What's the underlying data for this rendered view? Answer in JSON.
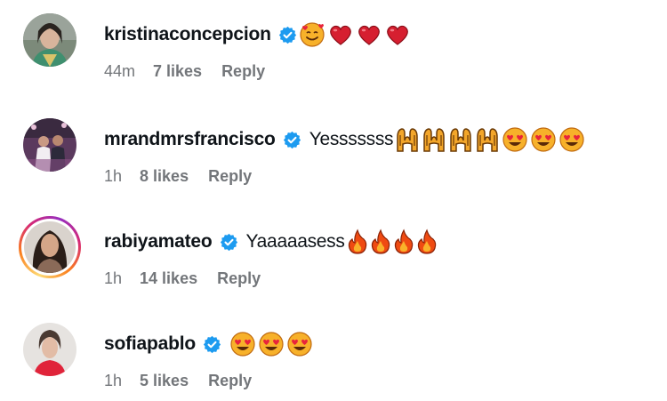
{
  "accent_verified": "#1d9bf0",
  "comments": [
    {
      "username": "kristinaconcepcion",
      "verified": true,
      "text": "",
      "emojis": [
        "smiling-face-with-hearts",
        "red-heart",
        "red-heart",
        "red-heart"
      ],
      "time": "44m",
      "likes": "7 likes",
      "reply": "Reply"
    },
    {
      "username": "mrandmrsfrancisco",
      "verified": true,
      "text": "Yesssssss",
      "emojis": [
        "raising-hands",
        "raising-hands",
        "raising-hands",
        "raising-hands",
        "heart-eyes",
        "heart-eyes",
        "heart-eyes"
      ],
      "time": "1h",
      "likes": "8 likes",
      "reply": "Reply"
    },
    {
      "username": "rabiyamateo",
      "verified": true,
      "text": "Yaaaaasess",
      "emojis": [
        "fire",
        "fire",
        "fire",
        "fire"
      ],
      "time": "1h",
      "likes": "14 likes",
      "reply": "Reply"
    },
    {
      "username": "sofiapablo",
      "verified": true,
      "text": "",
      "emojis": [
        "heart-eyes",
        "heart-eyes",
        "heart-eyes"
      ],
      "time": "1h",
      "likes": "5 likes",
      "reply": "Reply"
    }
  ]
}
